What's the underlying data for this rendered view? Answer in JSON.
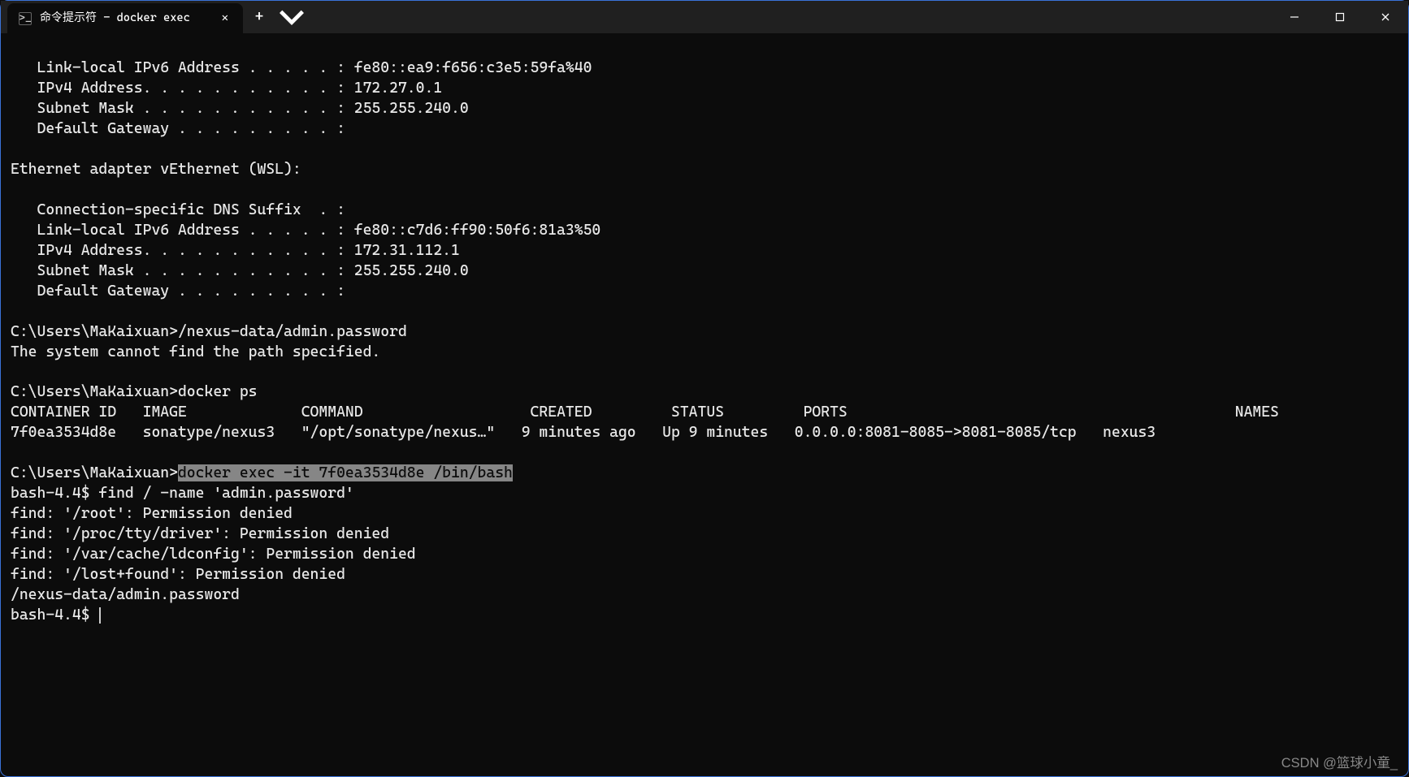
{
  "titlebar": {
    "tab_title": "命令提示符 - docker  exec",
    "close_glyph": "✕"
  },
  "watermark": "CSDN @篮球小童_",
  "term": {
    "l01": "   Link-local IPv6 Address . . . . . : fe80::ea9:f656:c3e5:59fa%40",
    "l02": "   IPv4 Address. . . . . . . . . . . : 172.27.0.1",
    "l03": "   Subnet Mask . . . . . . . . . . . : 255.255.240.0",
    "l04": "   Default Gateway . . . . . . . . . :",
    "l05": "",
    "l06": "Ethernet adapter vEthernet (WSL):",
    "l07": "",
    "l08": "   Connection-specific DNS Suffix  . :",
    "l09": "   Link-local IPv6 Address . . . . . : fe80::c7d6:ff90:50f6:81a3%50",
    "l10": "   IPv4 Address. . . . . . . . . . . : 172.31.112.1",
    "l11": "   Subnet Mask . . . . . . . . . . . : 255.255.240.0",
    "l12": "   Default Gateway . . . . . . . . . :",
    "l13": "",
    "l14": "C:\\Users\\MaKaixuan>/nexus-data/admin.password",
    "l15": "The system cannot find the path specified.",
    "l16": "",
    "l17": "C:\\Users\\MaKaixuan>docker ps",
    "l18": "CONTAINER ID   IMAGE             COMMAND                   CREATED         STATUS         PORTS                                            NAMES",
    "l19": "7f0ea3534d8e   sonatype/nexus3   \"/opt/sonatype/nexus…\"   9 minutes ago   Up 9 minutes   0.0.0.0:8081-8085->8081-8085/tcp   nexus3",
    "l20": "",
    "l21_prefix": "C:\\Users\\MaKaixuan>",
    "l21_highlight": "docker exec -it 7f0ea3534d8e /bin/bash",
    "l22": "bash-4.4$ find / -name 'admin.password'",
    "l23": "find: '/root': Permission denied",
    "l24": "find: '/proc/tty/driver': Permission denied",
    "l25": "find: '/var/cache/ldconfig': Permission denied",
    "l26": "find: '/lost+found': Permission denied",
    "l27": "/nexus-data/admin.password",
    "l28": "bash-4.4$ "
  }
}
